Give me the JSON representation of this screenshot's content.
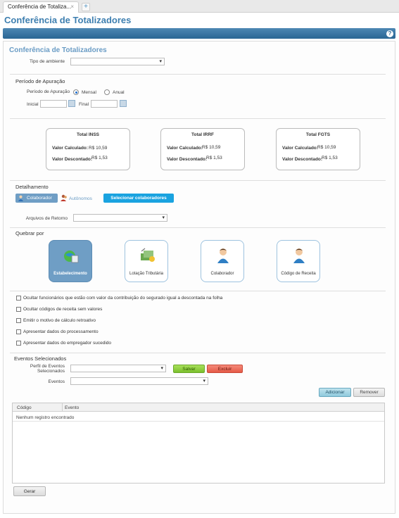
{
  "tabs": {
    "active_label": "Conferência de Totaliza...",
    "close": "×",
    "add": "+"
  },
  "page": {
    "title": "Conferência de Totalizadores",
    "help": "?"
  },
  "form": {
    "title": "Conferência de Totalizadores",
    "tipo_ambiente_label": "Tipo de ambiente",
    "tipo_ambiente_value": "",
    "periodo": {
      "heading": "Período de Apuração",
      "label": "Período de Apuração",
      "options": [
        "Mensal",
        "Anual"
      ],
      "selected": "Mensal",
      "inicial_label": "Inicial",
      "final_label": "Final"
    },
    "totals": [
      {
        "title": "Total INSS",
        "calc_label": "Valor Calculado:",
        "calc_value": "R$ 10,59",
        "desc_label": "Valor Descontado:",
        "desc_value": "R$ 1,53"
      },
      {
        "title": "Total IRRF",
        "calc_label": "Valor Calculado:",
        "calc_value": "R$ 10,59",
        "desc_label": "Valor Descontado:",
        "desc_value": "R$ 1,53"
      },
      {
        "title": "Total FGTS",
        "calc_label": "Valor Calculado:",
        "calc_value": "R$ 10,59",
        "desc_label": "Valor Descontado:",
        "desc_value": "R$ 1,53"
      }
    ],
    "detalhamento": {
      "heading": "Detalhamento",
      "colaborador": "Colaborador",
      "autonomos": "Autônomos",
      "selecionar": "Selecionar colaboradores",
      "arquivos_label": "Arquivos de Retorno"
    },
    "quebrar": {
      "heading": "Quebrar por",
      "options": [
        "Estabelecimento",
        "Lotação Tributária",
        "Colaborador",
        "Código de Receita"
      ],
      "selected": "Estabelecimento"
    },
    "checkboxes": [
      "Ocultar funcionários que estão com valor da contribuição do segurado igual a descontada na folha",
      "Ocultar códigos de receita sem valores",
      "Emitir o motivo de cálculo retroativo",
      "Apresentar dados do processamento",
      "Apresentar dados do empregador sucedido"
    ],
    "eventos": {
      "heading": "Eventos Selecionados",
      "perfil_label_1": "Perfil de Eventos",
      "perfil_label_2": "Selecionados",
      "salvar": "Salvar",
      "excluir": "Excluir",
      "eventos_label": "Eventos",
      "adicionar": "Adicionar",
      "remover": "Remover"
    },
    "grid": {
      "columns": [
        "Código",
        "Evento"
      ],
      "empty": "Nenhum registro encontrado"
    },
    "gerar": "Gerar"
  },
  "colors": {
    "title": "#3e7fb0",
    "bar": "#2a6694",
    "accent": "#1aa3e0",
    "salvar": "#8ccf3c",
    "excluir": "#ef6b5a"
  }
}
